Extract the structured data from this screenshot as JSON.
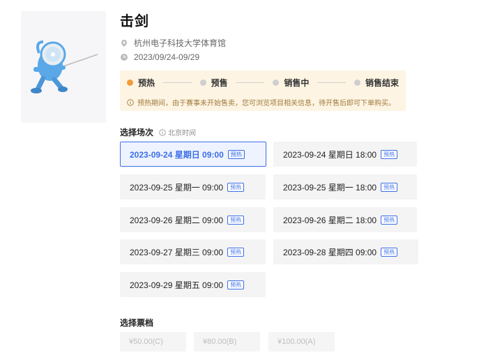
{
  "event": {
    "title": "击剑",
    "venue": "杭州电子科技大学体育馆",
    "date_range": "2023/09/24-09/29"
  },
  "stages": [
    {
      "label": "预热",
      "active": true
    },
    {
      "label": "预售",
      "active": false
    },
    {
      "label": "销售中",
      "active": false
    },
    {
      "label": "销售结束",
      "active": false
    }
  ],
  "notice": "预热期间，由于赛事未开始售卖，您可浏览项目相关信息，待开售后即可下单购买。",
  "sessions_section": {
    "label": "选择场次",
    "timezone": "北京时间"
  },
  "sessions": [
    {
      "label": "2023-09-24 星期日 09:00",
      "badge": "预热",
      "selected": true
    },
    {
      "label": "2023-09-24 星期日 18:00",
      "badge": "预热",
      "selected": false
    },
    {
      "label": "2023-09-25 星期一 09:00",
      "badge": "预热",
      "selected": false
    },
    {
      "label": "2023-09-25 星期一 18:00",
      "badge": "预热",
      "selected": false
    },
    {
      "label": "2023-09-26 星期二 09:00",
      "badge": "预热",
      "selected": false
    },
    {
      "label": "2023-09-26 星期二 18:00",
      "badge": "预热",
      "selected": false
    },
    {
      "label": "2023-09-27 星期三 09:00",
      "badge": "预热",
      "selected": false
    },
    {
      "label": "2023-09-28 星期四 09:00",
      "badge": "预热",
      "selected": false
    },
    {
      "label": "2023-09-29 星期五 09:00",
      "badge": "预热",
      "selected": false
    }
  ],
  "tiers_section": {
    "label": "选择票档"
  },
  "tiers": [
    {
      "label": "¥50.00(C)"
    },
    {
      "label": "¥80.00(B)"
    },
    {
      "label": "¥100.00(A)"
    }
  ],
  "colors": {
    "accent": "#3b6fe6",
    "stage_active": "#f29b38",
    "notice_bg": "#fdf4e3"
  }
}
